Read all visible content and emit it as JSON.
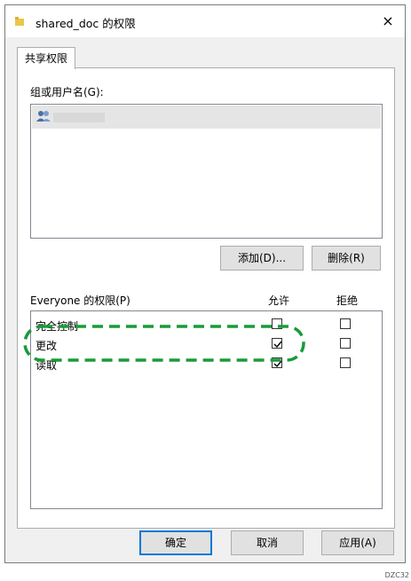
{
  "window": {
    "title": "shared_doc 的权限",
    "close_glyph": "×"
  },
  "tabs": [
    {
      "label": "共享权限",
      "selected": true
    }
  ],
  "groups": {
    "label": "组或用户名(G):",
    "users": [
      {
        "icon": "users-icon",
        "name": "",
        "selected": true
      }
    ]
  },
  "buttons": {
    "add": "添加(D)...",
    "remove": "删除(R)"
  },
  "permissions": {
    "header": "Everyone 的权限(P)",
    "allow_header": "允许",
    "deny_header": "拒绝",
    "rows": [
      {
        "name": "完全控制",
        "allow": false,
        "deny": false
      },
      {
        "name": "更改",
        "allow": true,
        "deny": false
      },
      {
        "name": "读取",
        "allow": true,
        "deny": false
      }
    ]
  },
  "footer": {
    "ok": "确定",
    "cancel": "取消",
    "apply": "应用(A)"
  },
  "annotation": {
    "highlight_color": "#1a9a3a"
  },
  "figure_code": "DZC32"
}
